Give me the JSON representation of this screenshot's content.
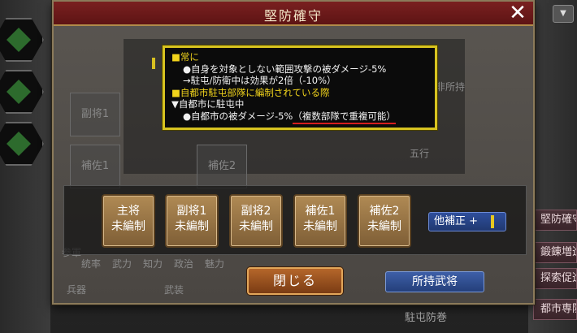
{
  "dialog": {
    "title": "堅防確守",
    "close_glyph": "✕"
  },
  "tooltip": {
    "lines": [
      {
        "text": "■常に",
        "style": "yellow"
      },
      {
        "text": "●自身を対象としない範囲攻撃の被ダメージ-5%",
        "style": "white-indent"
      },
      {
        "text": "→駐屯/防衛中は効果が2倍（-10%）",
        "style": "white-indent"
      },
      {
        "text": "■自都市駐屯部隊に編制されている際",
        "style": "yellow"
      },
      {
        "text": "▼自都市に駐屯中",
        "style": "white"
      },
      {
        "text": "●自都市の被ダメージ-5%",
        "style": "white-indent"
      },
      {
        "text": "（複数部隊で重複可能）",
        "style": "white-underline"
      }
    ]
  },
  "slots": [
    {
      "role": "主将",
      "status": "未編制"
    },
    {
      "role": "副将1",
      "status": "未編制"
    },
    {
      "role": "副将2",
      "status": "未編制"
    },
    {
      "role": "補佐1",
      "status": "未編制"
    },
    {
      "role": "補佐2",
      "status": "未編制"
    }
  ],
  "extra_bonus_label": "他補正 +",
  "buttons": {
    "close_label": "閉じる",
    "owned_generals_label": "所持武将"
  },
  "background": {
    "ghost_slot_labels": [
      "副将1",
      "補佐1",
      "補佐2"
    ],
    "ghost_texts": [
      "戦法非所持",
      "統率",
      "武力",
      "知力",
      "政治",
      "魅力",
      "兵器",
      "武装",
      "未編制",
      "未編制",
      "参軍",
      "五行"
    ],
    "right_buttons": [
      "堅防確守",
      "鍛錬増進",
      "探索促進",
      "都市専防"
    ],
    "bottom_text": "駐屯防巻"
  },
  "colors": {
    "title_bar": "#7a2020",
    "tooltip_border": "#d7c320",
    "tooltip_yellow": "#f2d41c",
    "underline_red": "#d61e1e",
    "slot_gold": "#b08a54",
    "close_btn_orange": "#b5662a",
    "blue_btn": "#3e5fa8"
  }
}
